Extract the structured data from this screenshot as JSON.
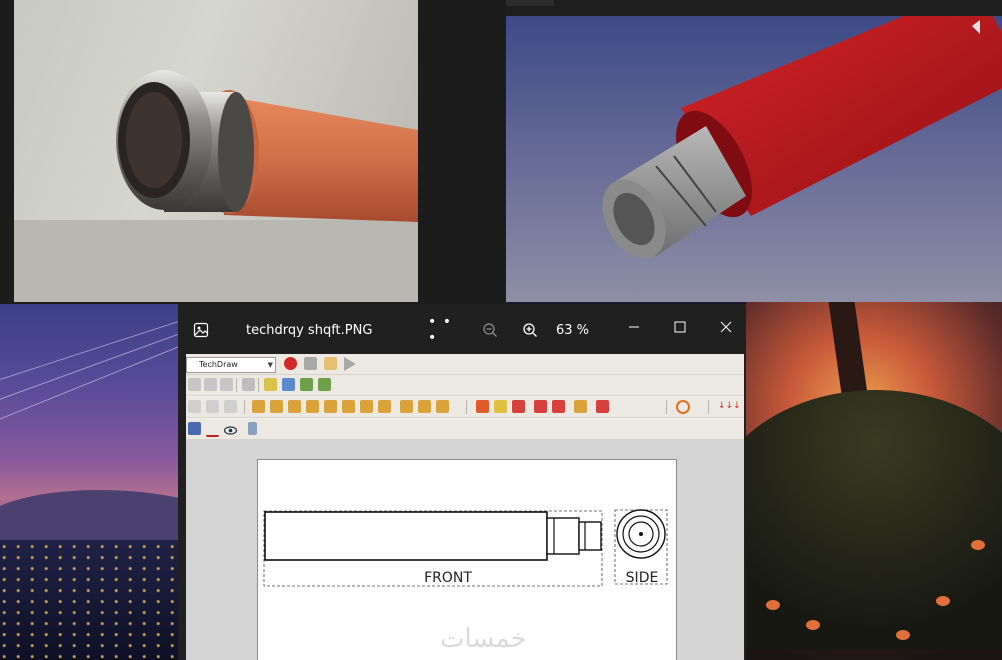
{
  "viewer": {
    "title": "techdrqy shqft.PNG",
    "more": "• • •",
    "zoom_level": "63 %"
  },
  "freecad": {
    "workbench": "TechDraw",
    "front_label": "FRONT",
    "side_label": "SIDE"
  },
  "watermark": "خمسات",
  "colors": {
    "viewer_bg": "#202020",
    "record": "#d22a2a",
    "shaft_red": "#b8141a",
    "shaft_gray": "#9c9c9c",
    "hose_orange": "#d0704a"
  }
}
